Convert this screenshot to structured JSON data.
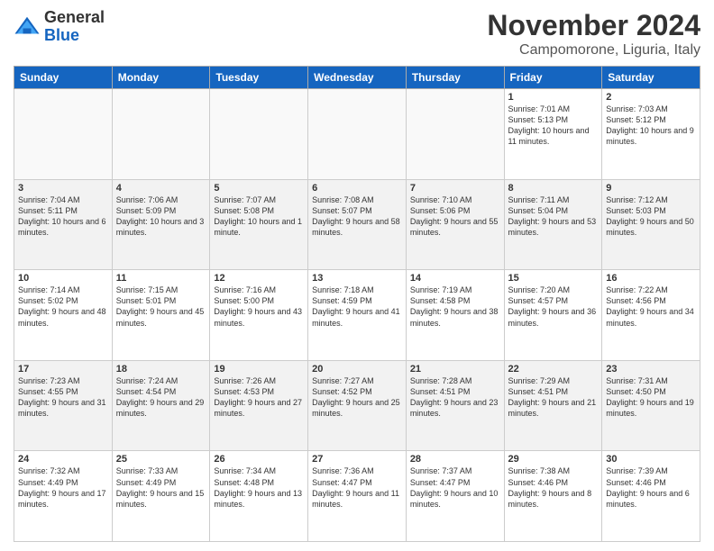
{
  "header": {
    "logo_general": "General",
    "logo_blue": "Blue",
    "month_title": "November 2024",
    "location": "Campomorone, Liguria, Italy"
  },
  "days_of_week": [
    "Sunday",
    "Monday",
    "Tuesday",
    "Wednesday",
    "Thursday",
    "Friday",
    "Saturday"
  ],
  "weeks": [
    {
      "shaded": false,
      "days": [
        {
          "num": "",
          "info": ""
        },
        {
          "num": "",
          "info": ""
        },
        {
          "num": "",
          "info": ""
        },
        {
          "num": "",
          "info": ""
        },
        {
          "num": "",
          "info": ""
        },
        {
          "num": "1",
          "info": "Sunrise: 7:01 AM\nSunset: 5:13 PM\nDaylight: 10 hours and 11 minutes."
        },
        {
          "num": "2",
          "info": "Sunrise: 7:03 AM\nSunset: 5:12 PM\nDaylight: 10 hours and 9 minutes."
        }
      ]
    },
    {
      "shaded": true,
      "days": [
        {
          "num": "3",
          "info": "Sunrise: 7:04 AM\nSunset: 5:11 PM\nDaylight: 10 hours and 6 minutes."
        },
        {
          "num": "4",
          "info": "Sunrise: 7:06 AM\nSunset: 5:09 PM\nDaylight: 10 hours and 3 minutes."
        },
        {
          "num": "5",
          "info": "Sunrise: 7:07 AM\nSunset: 5:08 PM\nDaylight: 10 hours and 1 minute."
        },
        {
          "num": "6",
          "info": "Sunrise: 7:08 AM\nSunset: 5:07 PM\nDaylight: 9 hours and 58 minutes."
        },
        {
          "num": "7",
          "info": "Sunrise: 7:10 AM\nSunset: 5:06 PM\nDaylight: 9 hours and 55 minutes."
        },
        {
          "num": "8",
          "info": "Sunrise: 7:11 AM\nSunset: 5:04 PM\nDaylight: 9 hours and 53 minutes."
        },
        {
          "num": "9",
          "info": "Sunrise: 7:12 AM\nSunset: 5:03 PM\nDaylight: 9 hours and 50 minutes."
        }
      ]
    },
    {
      "shaded": false,
      "days": [
        {
          "num": "10",
          "info": "Sunrise: 7:14 AM\nSunset: 5:02 PM\nDaylight: 9 hours and 48 minutes."
        },
        {
          "num": "11",
          "info": "Sunrise: 7:15 AM\nSunset: 5:01 PM\nDaylight: 9 hours and 45 minutes."
        },
        {
          "num": "12",
          "info": "Sunrise: 7:16 AM\nSunset: 5:00 PM\nDaylight: 9 hours and 43 minutes."
        },
        {
          "num": "13",
          "info": "Sunrise: 7:18 AM\nSunset: 4:59 PM\nDaylight: 9 hours and 41 minutes."
        },
        {
          "num": "14",
          "info": "Sunrise: 7:19 AM\nSunset: 4:58 PM\nDaylight: 9 hours and 38 minutes."
        },
        {
          "num": "15",
          "info": "Sunrise: 7:20 AM\nSunset: 4:57 PM\nDaylight: 9 hours and 36 minutes."
        },
        {
          "num": "16",
          "info": "Sunrise: 7:22 AM\nSunset: 4:56 PM\nDaylight: 9 hours and 34 minutes."
        }
      ]
    },
    {
      "shaded": true,
      "days": [
        {
          "num": "17",
          "info": "Sunrise: 7:23 AM\nSunset: 4:55 PM\nDaylight: 9 hours and 31 minutes."
        },
        {
          "num": "18",
          "info": "Sunrise: 7:24 AM\nSunset: 4:54 PM\nDaylight: 9 hours and 29 minutes."
        },
        {
          "num": "19",
          "info": "Sunrise: 7:26 AM\nSunset: 4:53 PM\nDaylight: 9 hours and 27 minutes."
        },
        {
          "num": "20",
          "info": "Sunrise: 7:27 AM\nSunset: 4:52 PM\nDaylight: 9 hours and 25 minutes."
        },
        {
          "num": "21",
          "info": "Sunrise: 7:28 AM\nSunset: 4:51 PM\nDaylight: 9 hours and 23 minutes."
        },
        {
          "num": "22",
          "info": "Sunrise: 7:29 AM\nSunset: 4:51 PM\nDaylight: 9 hours and 21 minutes."
        },
        {
          "num": "23",
          "info": "Sunrise: 7:31 AM\nSunset: 4:50 PM\nDaylight: 9 hours and 19 minutes."
        }
      ]
    },
    {
      "shaded": false,
      "days": [
        {
          "num": "24",
          "info": "Sunrise: 7:32 AM\nSunset: 4:49 PM\nDaylight: 9 hours and 17 minutes."
        },
        {
          "num": "25",
          "info": "Sunrise: 7:33 AM\nSunset: 4:49 PM\nDaylight: 9 hours and 15 minutes."
        },
        {
          "num": "26",
          "info": "Sunrise: 7:34 AM\nSunset: 4:48 PM\nDaylight: 9 hours and 13 minutes."
        },
        {
          "num": "27",
          "info": "Sunrise: 7:36 AM\nSunset: 4:47 PM\nDaylight: 9 hours and 11 minutes."
        },
        {
          "num": "28",
          "info": "Sunrise: 7:37 AM\nSunset: 4:47 PM\nDaylight: 9 hours and 10 minutes."
        },
        {
          "num": "29",
          "info": "Sunrise: 7:38 AM\nSunset: 4:46 PM\nDaylight: 9 hours and 8 minutes."
        },
        {
          "num": "30",
          "info": "Sunrise: 7:39 AM\nSunset: 4:46 PM\nDaylight: 9 hours and 6 minutes."
        }
      ]
    }
  ]
}
